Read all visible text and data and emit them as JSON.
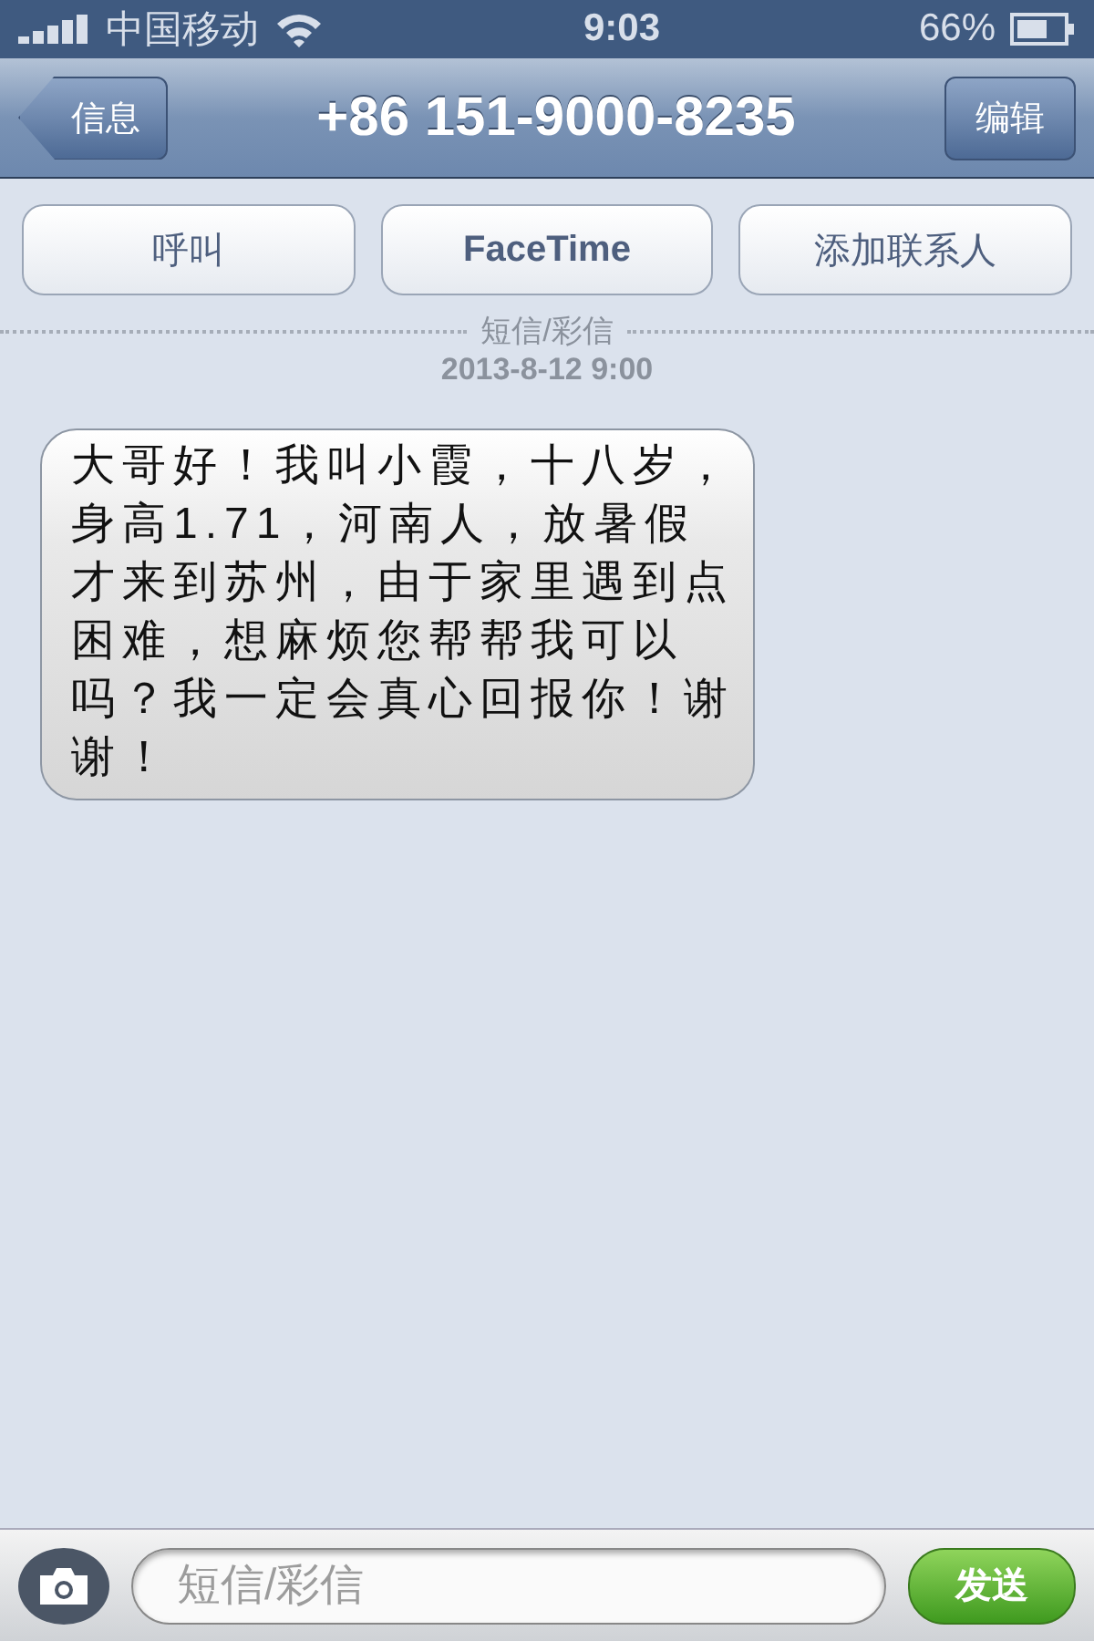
{
  "status_bar": {
    "carrier": "中国移动",
    "time": "9:03",
    "battery": "66%"
  },
  "nav": {
    "back": "信息",
    "title": "+86 151-9000-8235",
    "edit": "编辑"
  },
  "actions": [
    "呼叫",
    "FaceTime",
    "添加联系人"
  ],
  "thread": {
    "service": "短信/彩信",
    "timestamp": "2013-8-12 9:00"
  },
  "messages": [
    {
      "text": "大哥好！我叫小霞，十八岁，身高1.71，河南人，放暑假才来到苏州，由于家里遇到点困难，想麻烦您帮帮我可以吗？我一定会真心回报你！谢谢！",
      "kind": "incoming"
    }
  ],
  "composer": {
    "placeholder": "短信/彩信",
    "send": "发送"
  }
}
